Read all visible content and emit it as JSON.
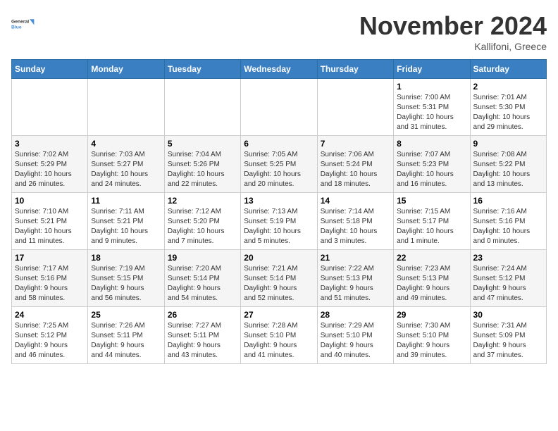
{
  "header": {
    "logo_line1": "General",
    "logo_line2": "Blue",
    "month": "November 2024",
    "location": "Kallifoni, Greece"
  },
  "weekdays": [
    "Sunday",
    "Monday",
    "Tuesday",
    "Wednesday",
    "Thursday",
    "Friday",
    "Saturday"
  ],
  "weeks": [
    [
      {
        "day": "",
        "info": ""
      },
      {
        "day": "",
        "info": ""
      },
      {
        "day": "",
        "info": ""
      },
      {
        "day": "",
        "info": ""
      },
      {
        "day": "",
        "info": ""
      },
      {
        "day": "1",
        "info": "Sunrise: 7:00 AM\nSunset: 5:31 PM\nDaylight: 10 hours\nand 31 minutes."
      },
      {
        "day": "2",
        "info": "Sunrise: 7:01 AM\nSunset: 5:30 PM\nDaylight: 10 hours\nand 29 minutes."
      }
    ],
    [
      {
        "day": "3",
        "info": "Sunrise: 7:02 AM\nSunset: 5:29 PM\nDaylight: 10 hours\nand 26 minutes."
      },
      {
        "day": "4",
        "info": "Sunrise: 7:03 AM\nSunset: 5:27 PM\nDaylight: 10 hours\nand 24 minutes."
      },
      {
        "day": "5",
        "info": "Sunrise: 7:04 AM\nSunset: 5:26 PM\nDaylight: 10 hours\nand 22 minutes."
      },
      {
        "day": "6",
        "info": "Sunrise: 7:05 AM\nSunset: 5:25 PM\nDaylight: 10 hours\nand 20 minutes."
      },
      {
        "day": "7",
        "info": "Sunrise: 7:06 AM\nSunset: 5:24 PM\nDaylight: 10 hours\nand 18 minutes."
      },
      {
        "day": "8",
        "info": "Sunrise: 7:07 AM\nSunset: 5:23 PM\nDaylight: 10 hours\nand 16 minutes."
      },
      {
        "day": "9",
        "info": "Sunrise: 7:08 AM\nSunset: 5:22 PM\nDaylight: 10 hours\nand 13 minutes."
      }
    ],
    [
      {
        "day": "10",
        "info": "Sunrise: 7:10 AM\nSunset: 5:21 PM\nDaylight: 10 hours\nand 11 minutes."
      },
      {
        "day": "11",
        "info": "Sunrise: 7:11 AM\nSunset: 5:21 PM\nDaylight: 10 hours\nand 9 minutes."
      },
      {
        "day": "12",
        "info": "Sunrise: 7:12 AM\nSunset: 5:20 PM\nDaylight: 10 hours\nand 7 minutes."
      },
      {
        "day": "13",
        "info": "Sunrise: 7:13 AM\nSunset: 5:19 PM\nDaylight: 10 hours\nand 5 minutes."
      },
      {
        "day": "14",
        "info": "Sunrise: 7:14 AM\nSunset: 5:18 PM\nDaylight: 10 hours\nand 3 minutes."
      },
      {
        "day": "15",
        "info": "Sunrise: 7:15 AM\nSunset: 5:17 PM\nDaylight: 10 hours\nand 1 minute."
      },
      {
        "day": "16",
        "info": "Sunrise: 7:16 AM\nSunset: 5:16 PM\nDaylight: 10 hours\nand 0 minutes."
      }
    ],
    [
      {
        "day": "17",
        "info": "Sunrise: 7:17 AM\nSunset: 5:16 PM\nDaylight: 9 hours\nand 58 minutes."
      },
      {
        "day": "18",
        "info": "Sunrise: 7:19 AM\nSunset: 5:15 PM\nDaylight: 9 hours\nand 56 minutes."
      },
      {
        "day": "19",
        "info": "Sunrise: 7:20 AM\nSunset: 5:14 PM\nDaylight: 9 hours\nand 54 minutes."
      },
      {
        "day": "20",
        "info": "Sunrise: 7:21 AM\nSunset: 5:14 PM\nDaylight: 9 hours\nand 52 minutes."
      },
      {
        "day": "21",
        "info": "Sunrise: 7:22 AM\nSunset: 5:13 PM\nDaylight: 9 hours\nand 51 minutes."
      },
      {
        "day": "22",
        "info": "Sunrise: 7:23 AM\nSunset: 5:13 PM\nDaylight: 9 hours\nand 49 minutes."
      },
      {
        "day": "23",
        "info": "Sunrise: 7:24 AM\nSunset: 5:12 PM\nDaylight: 9 hours\nand 47 minutes."
      }
    ],
    [
      {
        "day": "24",
        "info": "Sunrise: 7:25 AM\nSunset: 5:12 PM\nDaylight: 9 hours\nand 46 minutes."
      },
      {
        "day": "25",
        "info": "Sunrise: 7:26 AM\nSunset: 5:11 PM\nDaylight: 9 hours\nand 44 minutes."
      },
      {
        "day": "26",
        "info": "Sunrise: 7:27 AM\nSunset: 5:11 PM\nDaylight: 9 hours\nand 43 minutes."
      },
      {
        "day": "27",
        "info": "Sunrise: 7:28 AM\nSunset: 5:10 PM\nDaylight: 9 hours\nand 41 minutes."
      },
      {
        "day": "28",
        "info": "Sunrise: 7:29 AM\nSunset: 5:10 PM\nDaylight: 9 hours\nand 40 minutes."
      },
      {
        "day": "29",
        "info": "Sunrise: 7:30 AM\nSunset: 5:10 PM\nDaylight: 9 hours\nand 39 minutes."
      },
      {
        "day": "30",
        "info": "Sunrise: 7:31 AM\nSunset: 5:09 PM\nDaylight: 9 hours\nand 37 minutes."
      }
    ]
  ]
}
